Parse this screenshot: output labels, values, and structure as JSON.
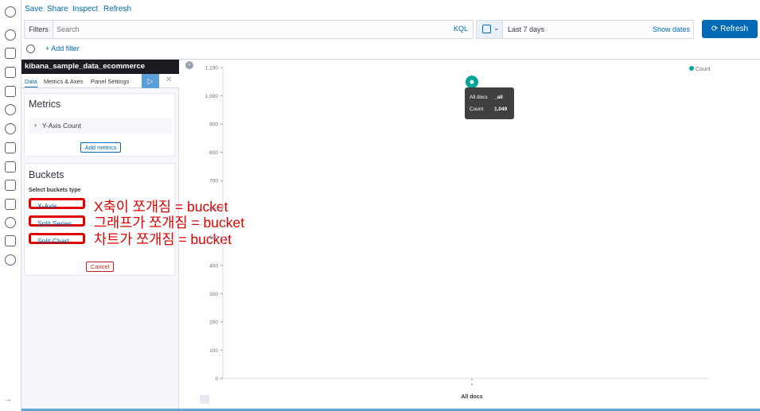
{
  "top_menu": {
    "save": "Save",
    "share": "Share",
    "inspect": "Inspect",
    "refresh": "Refresh"
  },
  "query_bar": {
    "filters_label": "Filters",
    "search_placeholder": "Search",
    "language": "KQL"
  },
  "date_picker": {
    "range": "Last 7 days",
    "show_dates": "Show dates"
  },
  "refresh_button": {
    "label": "Refresh",
    "icon": "refresh-icon"
  },
  "filter_row": {
    "add_filter": "+ Add filter"
  },
  "sidebar": {
    "index_pattern": "kibana_sample_data_ecommerce",
    "tabs": [
      "Data",
      "Metrics & Axes",
      "Panel Settings"
    ],
    "metrics": {
      "title": "Metrics",
      "items": [
        {
          "label": "Y-Axis Count"
        }
      ],
      "add_label": "Add metrics"
    },
    "buckets": {
      "title": "Buckets",
      "select_label": "Select buckets type",
      "types": [
        "X-Axis",
        "Split Series",
        "Split Chart"
      ],
      "cancel_label": "Cancel"
    }
  },
  "annotations": [
    "X축이 쪼개짐 = bucket",
    "그래프가 쪼개짐 = bucket",
    "차트가 쪼개짐 = bucket"
  ],
  "tooltip": {
    "rows": [
      {
        "label": "All docs",
        "value": "_all"
      },
      {
        "label": "Count",
        "value": "1,049"
      }
    ]
  },
  "colors": {
    "accent": "#006bb4",
    "series": "#00a69b",
    "annotation": "#e00000",
    "header_dark": "#1a1c21"
  },
  "chart_data": {
    "type": "scatter",
    "x": [
      "All docs"
    ],
    "series": [
      {
        "name": "Count",
        "values": [
          1049
        ]
      }
    ],
    "xlabel": "All docs",
    "x_tick_label": "*",
    "ylim": [
      0,
      1100
    ],
    "yticks": [
      0,
      100,
      200,
      300,
      400,
      500,
      600,
      700,
      800,
      900,
      1000,
      1100
    ],
    "ytick_labels": [
      "0",
      "100",
      "200",
      "300",
      "400",
      "500",
      "600",
      "700",
      "800",
      "900",
      "1,000",
      "1,100"
    ],
    "legend": {
      "entries": [
        "Count"
      ],
      "placement": "top-right"
    },
    "grid": false
  }
}
